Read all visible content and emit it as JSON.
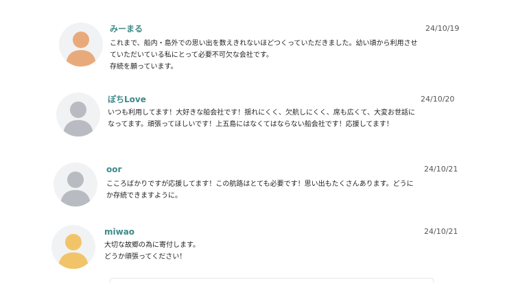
{
  "comments": [
    {
      "name": "みーまる",
      "date": "24/10/19",
      "lines": [
        "これまで、船内・島外での思い出を数えきれないほどつくっていただきました。幼い頃から利用させ",
        "ていただいている私にとって必要不可欠な会社です。",
        "存続を願っています。"
      ]
    },
    {
      "name": "ぽちLove",
      "date": "24/10/20",
      "lines": [
        "いつも利用してます！大好きな船会社です！揺れにくく、欠航しにくく、席も広くて、大変お世話に",
        "なってます。頑張ってほしいです！上五島にはなくてはならない船会社です！応援してます！"
      ]
    },
    {
      "name": "oor",
      "date": "24/10/21",
      "lines": [
        "こころばかりですが応援してます！この航路はとても必要です！思い出もたくさんあります。どうに",
        "か存続できますように。"
      ]
    },
    {
      "name": "miwao",
      "date": "24/10/21",
      "lines": [
        "大切な故郷の為に寄付します。",
        "どうか頑張ってください！"
      ]
    }
  ],
  "colors": {
    "name": "#3d8a88",
    "avatar_orange": "#e9aa7b",
    "avatar_gray": "#b8bcc2",
    "avatar_yellow": "#f2c46a"
  },
  "icons": [
    "user-avatar-icon"
  ]
}
